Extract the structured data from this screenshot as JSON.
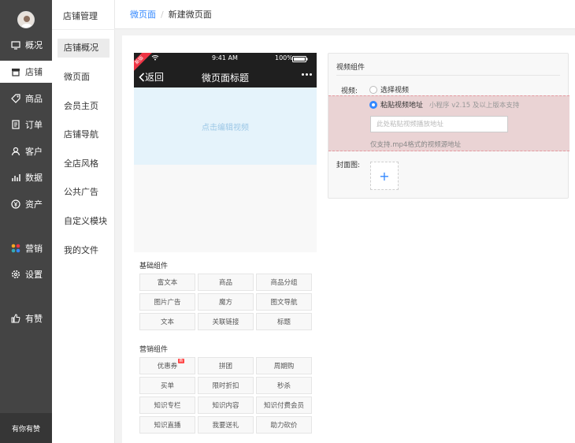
{
  "nav": {
    "items": [
      {
        "label": "概况",
        "icon": "monitor-icon"
      },
      {
        "label": "店铺",
        "icon": "shop-icon"
      },
      {
        "label": "商品",
        "icon": "tag-icon"
      },
      {
        "label": "订单",
        "icon": "order-icon"
      },
      {
        "label": "客户",
        "icon": "user-icon"
      },
      {
        "label": "数据",
        "icon": "chart-icon"
      },
      {
        "label": "资产",
        "icon": "money-icon"
      },
      {
        "label": "营销",
        "icon": "apps-icon"
      },
      {
        "label": "设置",
        "icon": "gear-icon"
      },
      {
        "label": "有赞",
        "icon": "thumb-icon"
      }
    ],
    "footer": "有你有赞"
  },
  "subnav": {
    "title": "店铺管理",
    "items": [
      "店铺概况",
      "微页面",
      "会员主页",
      "店铺导航",
      "全店风格",
      "公共广告",
      "自定义模块",
      "我的文件"
    ]
  },
  "breadcrumb": {
    "parent": "微页面",
    "current": "新建微页面"
  },
  "phone": {
    "ribbon": "新版",
    "time": "9:41 AM",
    "battery": "100%",
    "back": "返回",
    "title": "微页面标题",
    "video_placeholder": "点击编辑视频"
  },
  "components": {
    "basic_title": "基础组件",
    "basic": [
      "富文本",
      "商品",
      "商品分组",
      "图片广告",
      "魔方",
      "图文导航",
      "文本",
      "关联链接",
      "标题"
    ],
    "marketing_title": "营销组件",
    "marketing": [
      "优惠券",
      "拼团",
      "周期购",
      "买单",
      "限时折扣",
      "秒杀",
      "知识专栏",
      "知识内容",
      "知识付费会员",
      "知识直播",
      "我要送礼",
      "助力砍价"
    ],
    "new_tag": "新"
  },
  "settings": {
    "title": "视频组件",
    "video_label": "视频:",
    "option_select": "选择视频",
    "option_paste": "粘贴视频地址",
    "paste_hint": "小程序 v2.15 及以上版本支持",
    "url_placeholder": "此处粘贴视频播放地址",
    "url_value": "",
    "paste_note": "仅支持.mp4格式的视频源地址",
    "cover_label": "封面图:",
    "add_symbol": "+"
  },
  "colors": {
    "accent": "#3388ff",
    "nav_bg": "#444444",
    "highlight": "#ead3d4"
  }
}
